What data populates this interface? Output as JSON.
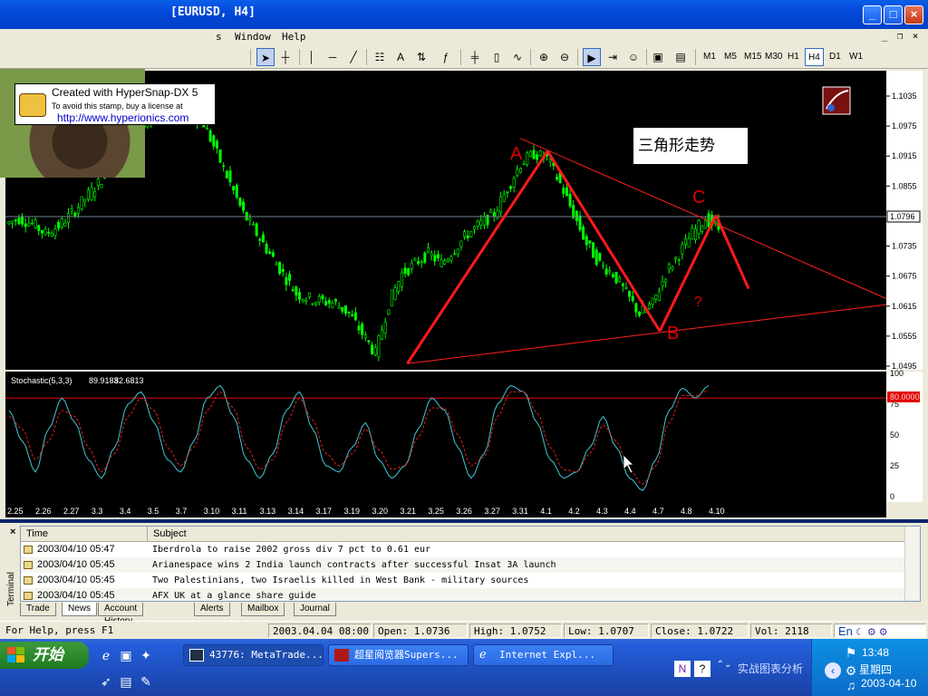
{
  "window": {
    "title": "[EURUSD, H4]",
    "controls": {
      "minimize": "_",
      "maximize": "□",
      "close": "×"
    }
  },
  "menu": {
    "items": [
      "s",
      "Window",
      "Help"
    ],
    "mdi": {
      "minimize": "_",
      "restore": "❐",
      "close": "×"
    }
  },
  "stamp": {
    "line1": "Created with HyperSnap-DX 5",
    "line2": "To avoid this stamp, buy a license at",
    "line3": "http://www.hyperionics.com"
  },
  "toolbar": {
    "timeframes": [
      "M1",
      "M5",
      "M15",
      "M30",
      "H1",
      "H4",
      "D1",
      "W1"
    ],
    "active_timeframe": "H4"
  },
  "chart_data": {
    "type": "candlestick",
    "symbol": "EURUSD",
    "timeframe": "H4",
    "ylim": [
      1.0495,
      1.1035
    ],
    "y_ticks": [
      "1.1035",
      "1.0975",
      "1.0915",
      "1.0855",
      "1.0796",
      "1.0735",
      "1.0675",
      "1.0615",
      "1.0555",
      "1.0495"
    ],
    "current_price": "1.0796",
    "x_ticks": [
      "2.25",
      "2.26",
      "2.27",
      "3.3",
      "3.4",
      "3.5",
      "3.7",
      "3.10",
      "3.11",
      "3.13",
      "3.14",
      "3.17",
      "3.19",
      "3.20",
      "3.21",
      "3.25",
      "3.26",
      "3.27",
      "3.31",
      "4.1",
      "4.2",
      "4.3",
      "4.4",
      "4.7",
      "4.8",
      "4.10"
    ],
    "closes": [
      1.079,
      1.078,
      1.076,
      1.0775,
      1.08,
      1.083,
      1.086,
      1.09,
      1.094,
      1.096,
      1.099,
      1.101,
      1.102,
      1.1,
      1.098,
      1.092,
      1.086,
      1.08,
      1.076,
      1.072,
      1.068,
      1.064,
      1.063,
      1.0625,
      1.062,
      1.06,
      1.056,
      1.052,
      1.062,
      1.068,
      1.07,
      1.072,
      1.07,
      1.073,
      1.076,
      1.078,
      1.08,
      1.085,
      1.09,
      1.092,
      1.091,
      1.086,
      1.08,
      1.074,
      1.07,
      1.068,
      1.064,
      1.06,
      1.062,
      1.068,
      1.072,
      1.076,
      1.079,
      1.077
    ],
    "annotations": {
      "title_box": "三角形走势",
      "labels": [
        "A",
        "B",
        "C",
        "?"
      ],
      "pattern_points": [
        {
          "label": "start",
          "x": "3.21",
          "y": 1.05
        },
        {
          "label": "A",
          "x": "4.1",
          "y": 1.0925
        },
        {
          "label": "B",
          "x": "4.7",
          "y": 1.0565
        },
        {
          "label": "C",
          "x": "4.10",
          "y": 1.0797
        },
        {
          "label": "projection",
          "x": "4.10+",
          "y": 1.065
        }
      ]
    },
    "stochastic": {
      "label": "Stochastic(5,3,3)",
      "main_value": "89.9183",
      "signal_value": "82.6813",
      "levels": [
        "100",
        "75",
        "50",
        "25",
        "0"
      ],
      "level_line_label": "80.0000",
      "ylim": [
        0,
        100
      ],
      "main": [
        70,
        45,
        20,
        55,
        80,
        60,
        30,
        15,
        40,
        75,
        85,
        60,
        30,
        20,
        45,
        80,
        90,
        65,
        30,
        15,
        35,
        70,
        85,
        55,
        25,
        20,
        40,
        60,
        30,
        15,
        25,
        55,
        80,
        70,
        40,
        15,
        35,
        75,
        90,
        85,
        60,
        30,
        15,
        20,
        40,
        65,
        40,
        15,
        5,
        30,
        70,
        88,
        80,
        90
      ],
      "signal": [
        65,
        55,
        30,
        45,
        70,
        65,
        40,
        20,
        35,
        65,
        80,
        70,
        40,
        25,
        40,
        70,
        85,
        72,
        40,
        22,
        30,
        60,
        80,
        62,
        35,
        25,
        35,
        55,
        38,
        22,
        25,
        48,
        72,
        72,
        50,
        25,
        32,
        65,
        85,
        85,
        68,
        40,
        22,
        20,
        35,
        58,
        45,
        22,
        10,
        25,
        60,
        82,
        82,
        86
      ]
    }
  },
  "terminal": {
    "label": "Terminal",
    "close": "×",
    "columns": [
      "Time",
      "Subject"
    ],
    "rows": [
      {
        "time": "2003/04/10 05:47",
        "subject": "Iberdrola to raise 2002 gross div 7 pct to 0.61 eur"
      },
      {
        "time": "2003/04/10 05:45",
        "subject": "Arianespace wins 2 India launch contracts after successful Insat 3A launch"
      },
      {
        "time": "2003/04/10 05:45",
        "subject": "Two Palestinians, two Israelis killed in West Bank - military sources"
      },
      {
        "time": "2003/04/10 05:45",
        "subject": "AFX UK at a glance share guide"
      }
    ],
    "tabs": [
      "Trade",
      "News",
      "Account History",
      "Alerts",
      "Mailbox",
      "Journal"
    ],
    "active_tab": "News"
  },
  "status": {
    "help": "For Help, press F1",
    "datetime": "2003.04.04 08:00",
    "open": "Open: 1.0736",
    "high": "High: 1.0752",
    "low": "Low: 1.0707",
    "close": "Close: 1.0722",
    "vol": "Vol: 2118"
  },
  "taskbar": {
    "start": "开始",
    "tasks": [
      "43776: MetaTrade...",
      "超星阅览器Supers...",
      "Internet Expl..."
    ],
    "tray_text": "实战图表分析",
    "lang": "En",
    "clock": {
      "time": "13:48",
      "day": "星期四",
      "date": "2003-04-10"
    }
  }
}
